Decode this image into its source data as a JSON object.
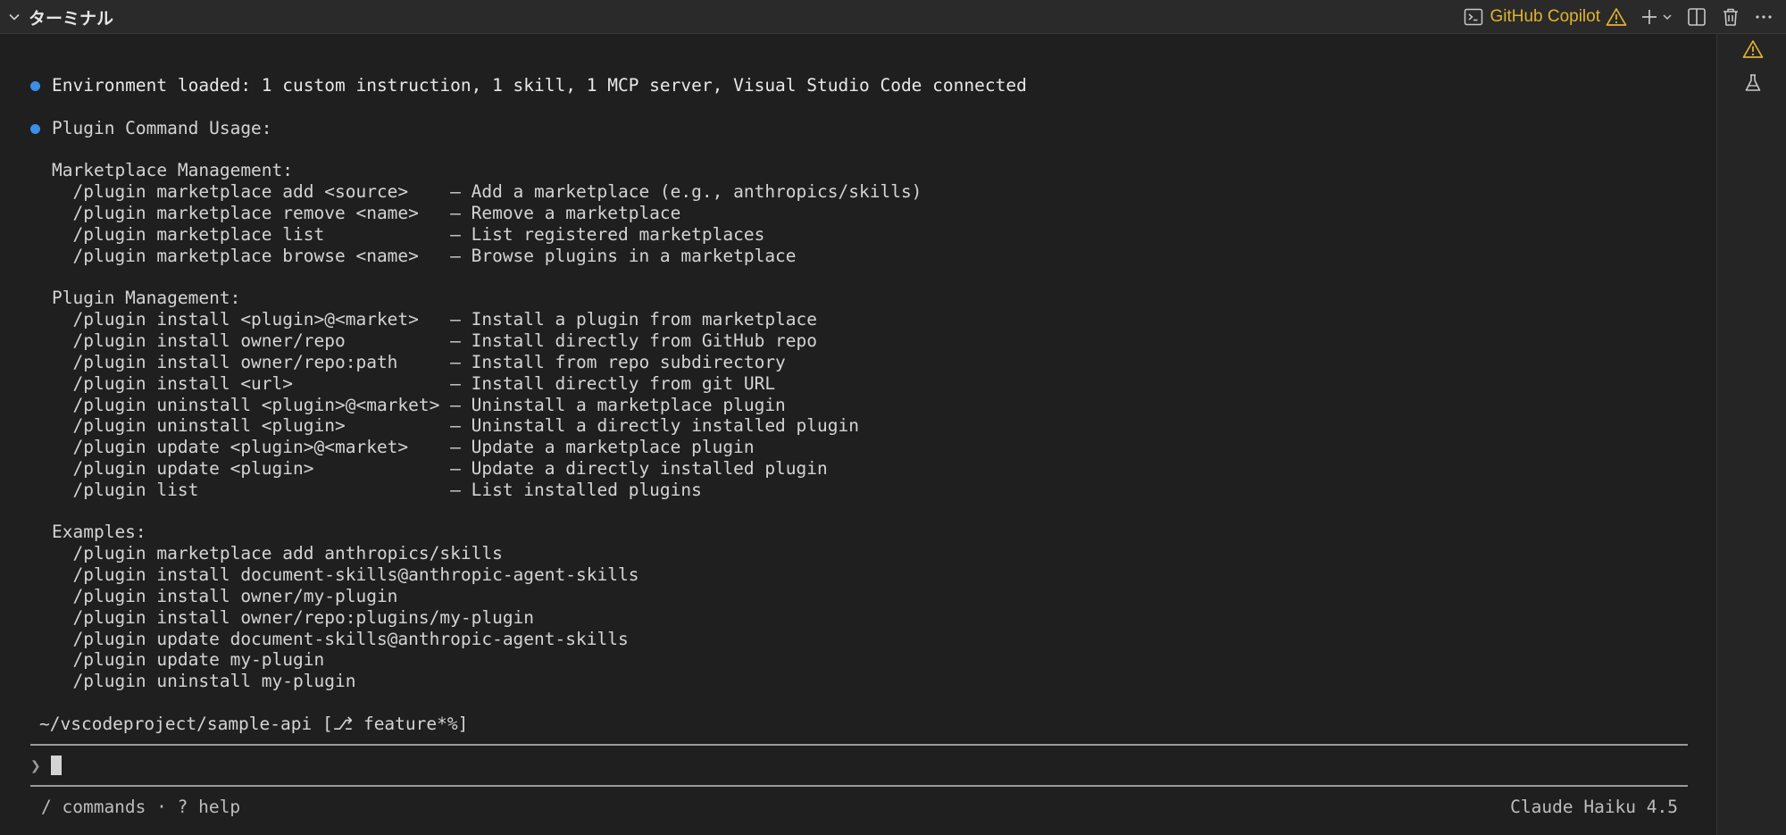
{
  "panel": {
    "title": "ターミナル",
    "copilot_label": "GitHub Copilot"
  },
  "terminal": {
    "status_line": "Environment loaded: 1 custom instruction, 1 skill, 1 MCP server, Visual Studio Code connected",
    "usage_heading": "Plugin Command Usage:",
    "lines": [
      "Marketplace Management:",
      "  /plugin marketplace add <source>    – Add a marketplace (e.g., anthropics/skills)",
      "  /plugin marketplace remove <name>   – Remove a marketplace",
      "  /plugin marketplace list            – List registered marketplaces",
      "  /plugin marketplace browse <name>   – Browse plugins in a marketplace",
      "",
      "Plugin Management:",
      "  /plugin install <plugin>@<market>   – Install a plugin from marketplace",
      "  /plugin install owner/repo          – Install directly from GitHub repo",
      "  /plugin install owner/repo:path     – Install from repo subdirectory",
      "  /plugin install <url>               – Install directly from git URL",
      "  /plugin uninstall <plugin>@<market> – Uninstall a marketplace plugin",
      "  /plugin uninstall <plugin>          – Uninstall a directly installed plugin",
      "  /plugin update <plugin>@<market>    – Update a marketplace plugin",
      "  /plugin update <plugin>             – Update a directly installed plugin",
      "  /plugin list                        – List installed plugins",
      "",
      "Examples:",
      "  /plugin marketplace add anthropics/skills",
      "  /plugin install document-skills@anthropic-agent-skills",
      "  /plugin install owner/my-plugin",
      "  /plugin install owner/repo:plugins/my-plugin",
      "  /plugin update document-skills@anthropic-agent-skills",
      "  /plugin update my-plugin",
      "  /plugin uninstall my-plugin"
    ],
    "cwd_path": "~/vscodeproject/sample-api",
    "branch": "[⎇ feature*%]",
    "prompt_symbol": "❯",
    "footer_hint": "/ commands · ? help",
    "model_name": "Claude Haiku 4.5"
  },
  "colors": {
    "accent_warning": "#e2b32d",
    "bullet_blue": "#3b8eea"
  },
  "icons": [
    "chevron-down-icon",
    "terminal-icon",
    "warning-icon",
    "plus-icon",
    "split-icon",
    "trash-icon",
    "more-icon",
    "flask-icon"
  ]
}
